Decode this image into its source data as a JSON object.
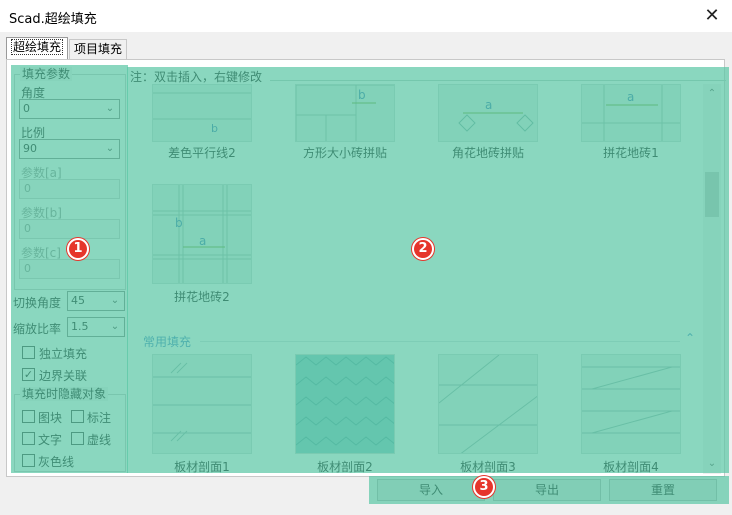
{
  "window": {
    "title": "Scad.超绘填充",
    "close_glyph": "✕"
  },
  "tabs": [
    {
      "label": "超绘填充",
      "active": true
    },
    {
      "label": "项目填充",
      "active": false
    }
  ],
  "fill_params": {
    "group_title": "填充参数",
    "angle_label": "角度",
    "angle_value": "0",
    "scale_label": "比例",
    "scale_value": "90",
    "param_a_label": "参数[a]",
    "param_a_value": "0",
    "param_b_label": "参数[b]",
    "param_b_value": "0",
    "param_c_label": "参数[c]",
    "param_c_value": "0"
  },
  "switch_angle": {
    "label": "切换角度",
    "value": "45"
  },
  "zoom_ratio": {
    "label": "缩放比率",
    "value": "1.5"
  },
  "options": {
    "independent_fill": {
      "label": "独立填充",
      "checked": false
    },
    "boundary_link": {
      "label": "边界关联",
      "checked": true
    }
  },
  "hide_objects": {
    "group_title": "填充时隐藏对象",
    "block": {
      "label": "图块",
      "checked": false
    },
    "annotation": {
      "label": "标注",
      "checked": false
    },
    "text": {
      "label": "文字",
      "checked": false
    },
    "dashed": {
      "label": "虚线",
      "checked": false
    },
    "gray_line": {
      "label": "灰色线",
      "checked": false
    }
  },
  "gallery": {
    "note": "注：双击插入，右键修改",
    "row1": [
      "差色平行线2",
      "方形大小砖拼贴",
      "角花地砖拼贴",
      "拼花地砖1"
    ],
    "row2": [
      "拼花地砖2"
    ],
    "section_title": "常用填充",
    "collapse_glyph": "⌃",
    "row3": [
      "板材剖面1",
      "板材剖面2",
      "板材剖面3",
      "板材剖面4"
    ],
    "dim_a": "a",
    "dim_b": "b"
  },
  "buttons": {
    "import": "导入",
    "export": "导出",
    "reset": "重置"
  },
  "scrollbar": {
    "up": "⌃",
    "down": "⌄"
  },
  "annotations": {
    "n1": "1",
    "n2": "2",
    "n3": "3",
    "highlight_color": "#58c6a4",
    "marker_color": "#e6352b"
  }
}
